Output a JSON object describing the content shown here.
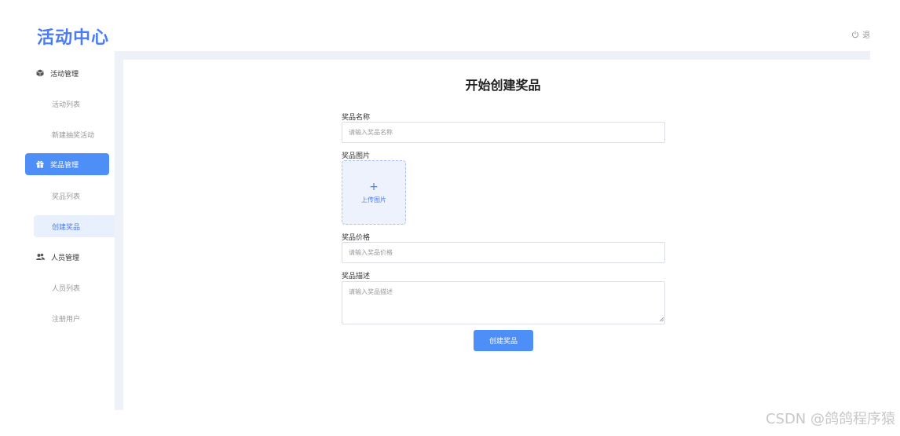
{
  "header": {
    "logo_text": "活动中心",
    "logout_label": "退"
  },
  "sidebar": {
    "groups": [
      {
        "label": "活动管理",
        "icon": "cube-icon",
        "items": [
          {
            "label": "活动列表"
          },
          {
            "label": "新建抽奖活动"
          }
        ]
      },
      {
        "label": "奖品管理",
        "icon": "gift-icon",
        "items": [
          {
            "label": "奖品列表"
          },
          {
            "label": "创建奖品"
          }
        ]
      },
      {
        "label": "人员管理",
        "icon": "users-icon",
        "items": [
          {
            "label": "人员列表"
          },
          {
            "label": "注册用户"
          }
        ]
      }
    ],
    "active_group": "奖品管理",
    "active_item": "创建奖品"
  },
  "form": {
    "title": "开始创建奖品",
    "name_label": "奖品名称",
    "name_placeholder": "请输入奖品名称",
    "image_label": "奖品图片",
    "upload_plus": "+",
    "upload_text": "上传图片",
    "price_label": "奖品价格",
    "price_placeholder": "请输入奖品价格",
    "desc_label": "奖品描述",
    "desc_placeholder": "请输入奖品描述",
    "submit_label": "创建奖品"
  },
  "watermark": "CSDN @鸽鸽程序猿",
  "colors": {
    "accent": "#4e8ef7",
    "logo": "#4a7cf7",
    "active_sub_bg": "#e8effd",
    "main_bg": "#eef1f8"
  }
}
